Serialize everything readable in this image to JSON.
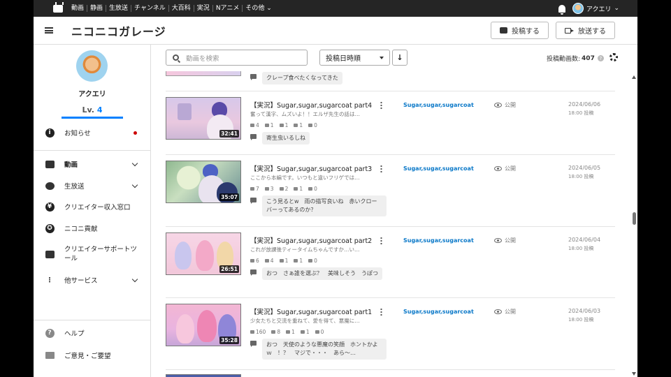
{
  "global_nav": {
    "items": [
      "動画",
      "静画",
      "生放送",
      "チャンネル",
      "大百科",
      "実況",
      "Nアニメ",
      "その他"
    ],
    "user_name": "アクエリ"
  },
  "header": {
    "brand": "ニコニコガレージ",
    "post_button": "投稿する",
    "broadcast_button": "放送する"
  },
  "sidebar": {
    "user_name": "アクエリ",
    "level_prefix": "Lv.",
    "level": "4",
    "items": [
      {
        "label": "お知らせ"
      },
      {
        "label": "動画"
      },
      {
        "label": "生放送"
      },
      {
        "label": "クリエイター収入窓口"
      },
      {
        "label": "ニコニ貢献"
      },
      {
        "label": "クリエイターサポートツール"
      },
      {
        "label": "他サービス"
      },
      {
        "label": "ヘルプ"
      },
      {
        "label": "ご意見・ご要望"
      }
    ]
  },
  "toolbar": {
    "search_placeholder": "動画を検索",
    "sort_label": "投稿日時順",
    "sort_direction": "↓",
    "count_label": "投稿動画数:",
    "count_value": "407"
  },
  "top_fragment_comment": "クレープ食べたくなってきた",
  "videos": [
    {
      "title": "【実況】Sugar,sugar,sugarcoat part4",
      "description": "奮って漢字、ムズいよ！！エルザ先生の話は…",
      "duration": "32:41",
      "stats": [
        "4",
        "1",
        "1",
        "1",
        "0"
      ],
      "comment": "寄生虫いるしね",
      "series": "Sugar,sugar,sugarcoat",
      "visibility": "公開",
      "date": "2024/06/06",
      "time": "18:00 投稿"
    },
    {
      "title": "【実況】Sugar,sugar,sugarcoat part3",
      "description": "ここから本編です。いつもと違いフリゲでは…",
      "duration": "35:07",
      "stats": [
        "7",
        "3",
        "2",
        "1",
        "0"
      ],
      "comment": "こう見るとw　雨の描写良いね　赤いクローバーってあるのか？",
      "series": "Sugar,sugar,sugarcoat",
      "visibility": "公開",
      "date": "2024/06/05",
      "time": "18:00 投稿"
    },
    {
      "title": "【実況】Sugar,sugar,sugarcoat part2",
      "description": "これが放課後ティータイムちゃんですか…い…",
      "duration": "26:51",
      "stats": [
        "6",
        "4",
        "1",
        "1",
        "0"
      ],
      "comment": "おつ　さぁ誰を選ぶ？　美味しそう　うぽつ",
      "series": "Sugar,sugar,sugarcoat",
      "visibility": "公開",
      "date": "2024/06/04",
      "time": "18:00 投稿"
    },
    {
      "title": "【実況】Sugar,sugar,sugarcoat part1",
      "description": "少女たちと交流を重ねて、愛を得て、悪魔に…",
      "duration": "35:28",
      "stats": [
        "160",
        "8",
        "1",
        "1",
        "0"
      ],
      "comment": "おつ　天使のような悪魔の笑顔　ホントかよｗ　！？　マジで・・・　あら～…",
      "series": "Sugar,sugar,sugarcoat",
      "visibility": "公開",
      "date": "2024/06/03",
      "time": "18:00 投稿"
    }
  ]
}
